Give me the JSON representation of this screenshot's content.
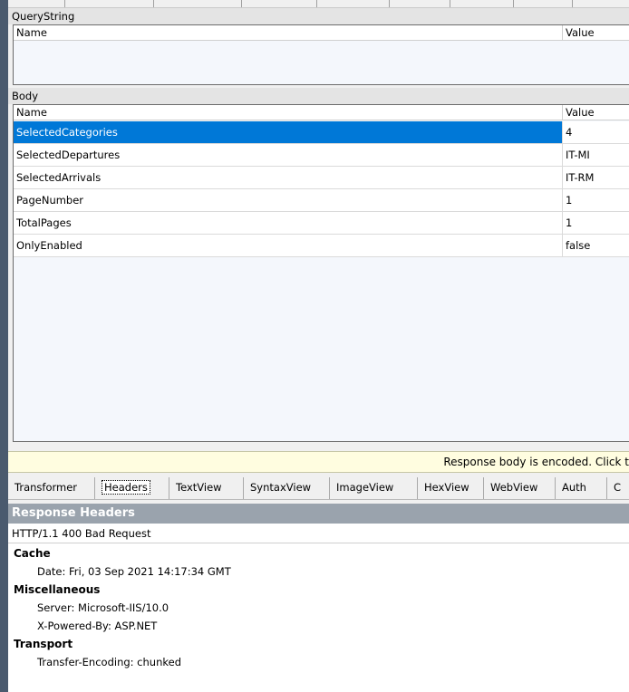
{
  "querystring": {
    "title": "QueryString",
    "col_name": "Name",
    "col_value": "Value"
  },
  "body": {
    "title": "Body",
    "col_name": "Name",
    "col_value": "Value",
    "rows": [
      {
        "name": "SelectedCategories",
        "value": "4"
      },
      {
        "name": "SelectedDepartures",
        "value": "IT-MI"
      },
      {
        "name": "SelectedArrivals",
        "value": "IT-RM"
      },
      {
        "name": "PageNumber",
        "value": "1"
      },
      {
        "name": "TotalPages",
        "value": "1"
      },
      {
        "name": "OnlyEnabled",
        "value": "false"
      }
    ]
  },
  "notice": "Response body is encoded. Click t",
  "tabs": [
    "Transformer",
    "Headers",
    "TextView",
    "SyntaxView",
    "ImageView",
    "HexView",
    "WebView",
    "Auth",
    "C"
  ],
  "response": {
    "title": "Response Headers",
    "status": "HTTP/1.1 400 Bad Request",
    "groups": [
      {
        "name": "Cache",
        "items": [
          "Date: Fri, 03 Sep 2021 14:17:34 GMT"
        ]
      },
      {
        "name": "Miscellaneous",
        "items": [
          "Server: Microsoft-IIS/10.0",
          "X-Powered-By: ASP.NET"
        ]
      },
      {
        "name": "Transport",
        "items": [
          "Transfer-Encoding: chunked"
        ]
      }
    ]
  },
  "colors": {
    "selection": "#0078d7",
    "response_header_bg": "#9aa3ad",
    "notice_bg": "#fffde0"
  }
}
